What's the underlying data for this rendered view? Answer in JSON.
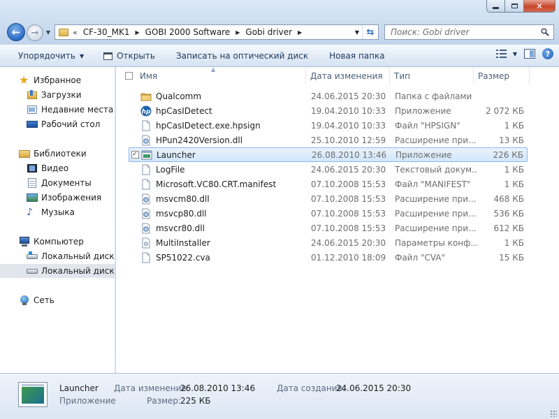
{
  "window": {
    "caption_buttons": {
      "minimize": "minimize-icon",
      "maximize": "maximize-icon",
      "close": "close-icon"
    }
  },
  "address_bar": {
    "overflow": "«",
    "crumbs": [
      "CF-30_MK1",
      "GOBI 2000 Software",
      "Gobi driver"
    ]
  },
  "search": {
    "placeholder": "Поиск: Gobi driver"
  },
  "toolbar": {
    "organize": "Упорядочить",
    "open": "Открыть",
    "burn": "Записать на оптический диск",
    "new_folder": "Новая папка"
  },
  "nav": {
    "favorites": "Избранное",
    "downloads": "Загрузки",
    "recent": "Недавние места",
    "desktop": "Рабочий стол",
    "libraries": "Библиотеки",
    "video": "Видео",
    "documents": "Документы",
    "images": "Изображения",
    "music": "Музыка",
    "computer": "Компьютер",
    "disk_c": "Локальный диск (C",
    "disk_e": "Локальный диск (E:",
    "network": "Сеть"
  },
  "columns": {
    "name": "Имя",
    "date": "Дата изменения",
    "type": "Тип",
    "size": "Размер"
  },
  "files": [
    {
      "name": "Qualcomm",
      "date": "24.06.2015 20:30",
      "type": "Папка с файлами",
      "size": "",
      "icon": "folder-icon"
    },
    {
      "name": "hpCasIDetect",
      "date": "19.04.2010 10:33",
      "type": "Приложение",
      "size": "2 072 КБ",
      "icon": "hp-icon"
    },
    {
      "name": "hpCasIDetect.exe.hpsign",
      "date": "19.04.2010 10:33",
      "type": "Файл \"HPSIGN\"",
      "size": "1 КБ",
      "icon": "file-icon"
    },
    {
      "name": "HPun2420Version.dll",
      "date": "25.10.2010 12:59",
      "type": "Расширение при...",
      "size": "13 КБ",
      "icon": "dll-icon"
    },
    {
      "name": "Launcher",
      "date": "26.08.2010 13:46",
      "type": "Приложение",
      "size": "226 КБ",
      "icon": "app-icon"
    },
    {
      "name": "LogFile",
      "date": "24.06.2015 20:30",
      "type": "Текстовый докум...",
      "size": "1 КБ",
      "icon": "file-icon"
    },
    {
      "name": "Microsoft.VC80.CRT.manifest",
      "date": "07.10.2008 15:53",
      "type": "Файл \"MANIFEST\"",
      "size": "1 КБ",
      "icon": "file-icon"
    },
    {
      "name": "msvcm80.dll",
      "date": "07.10.2008 15:53",
      "type": "Расширение при...",
      "size": "468 КБ",
      "icon": "dll-icon"
    },
    {
      "name": "msvcp80.dll",
      "date": "07.10.2008 15:53",
      "type": "Расширение при...",
      "size": "536 КБ",
      "icon": "dll-icon"
    },
    {
      "name": "msvcr80.dll",
      "date": "07.10.2008 15:53",
      "type": "Расширение при...",
      "size": "612 КБ",
      "icon": "dll-icon"
    },
    {
      "name": "MultiInstaller",
      "date": "24.06.2015 20:30",
      "type": "Параметры конф...",
      "size": "1 КБ",
      "icon": "config-icon"
    },
    {
      "name": "SP51022.cva",
      "date": "01.12.2010 18:09",
      "type": "Файл \"CVA\"",
      "size": "15 КБ",
      "icon": "file-icon"
    }
  ],
  "selected_index": 4,
  "details": {
    "name": "Launcher",
    "type": "Приложение",
    "modified_label": "Дата изменения:",
    "modified_value": "26.08.2010 13:46",
    "created_label": "Дата создания:",
    "created_value": "24.06.2015 20:30",
    "size_label": "Размер:",
    "size_value": "225 КБ"
  }
}
